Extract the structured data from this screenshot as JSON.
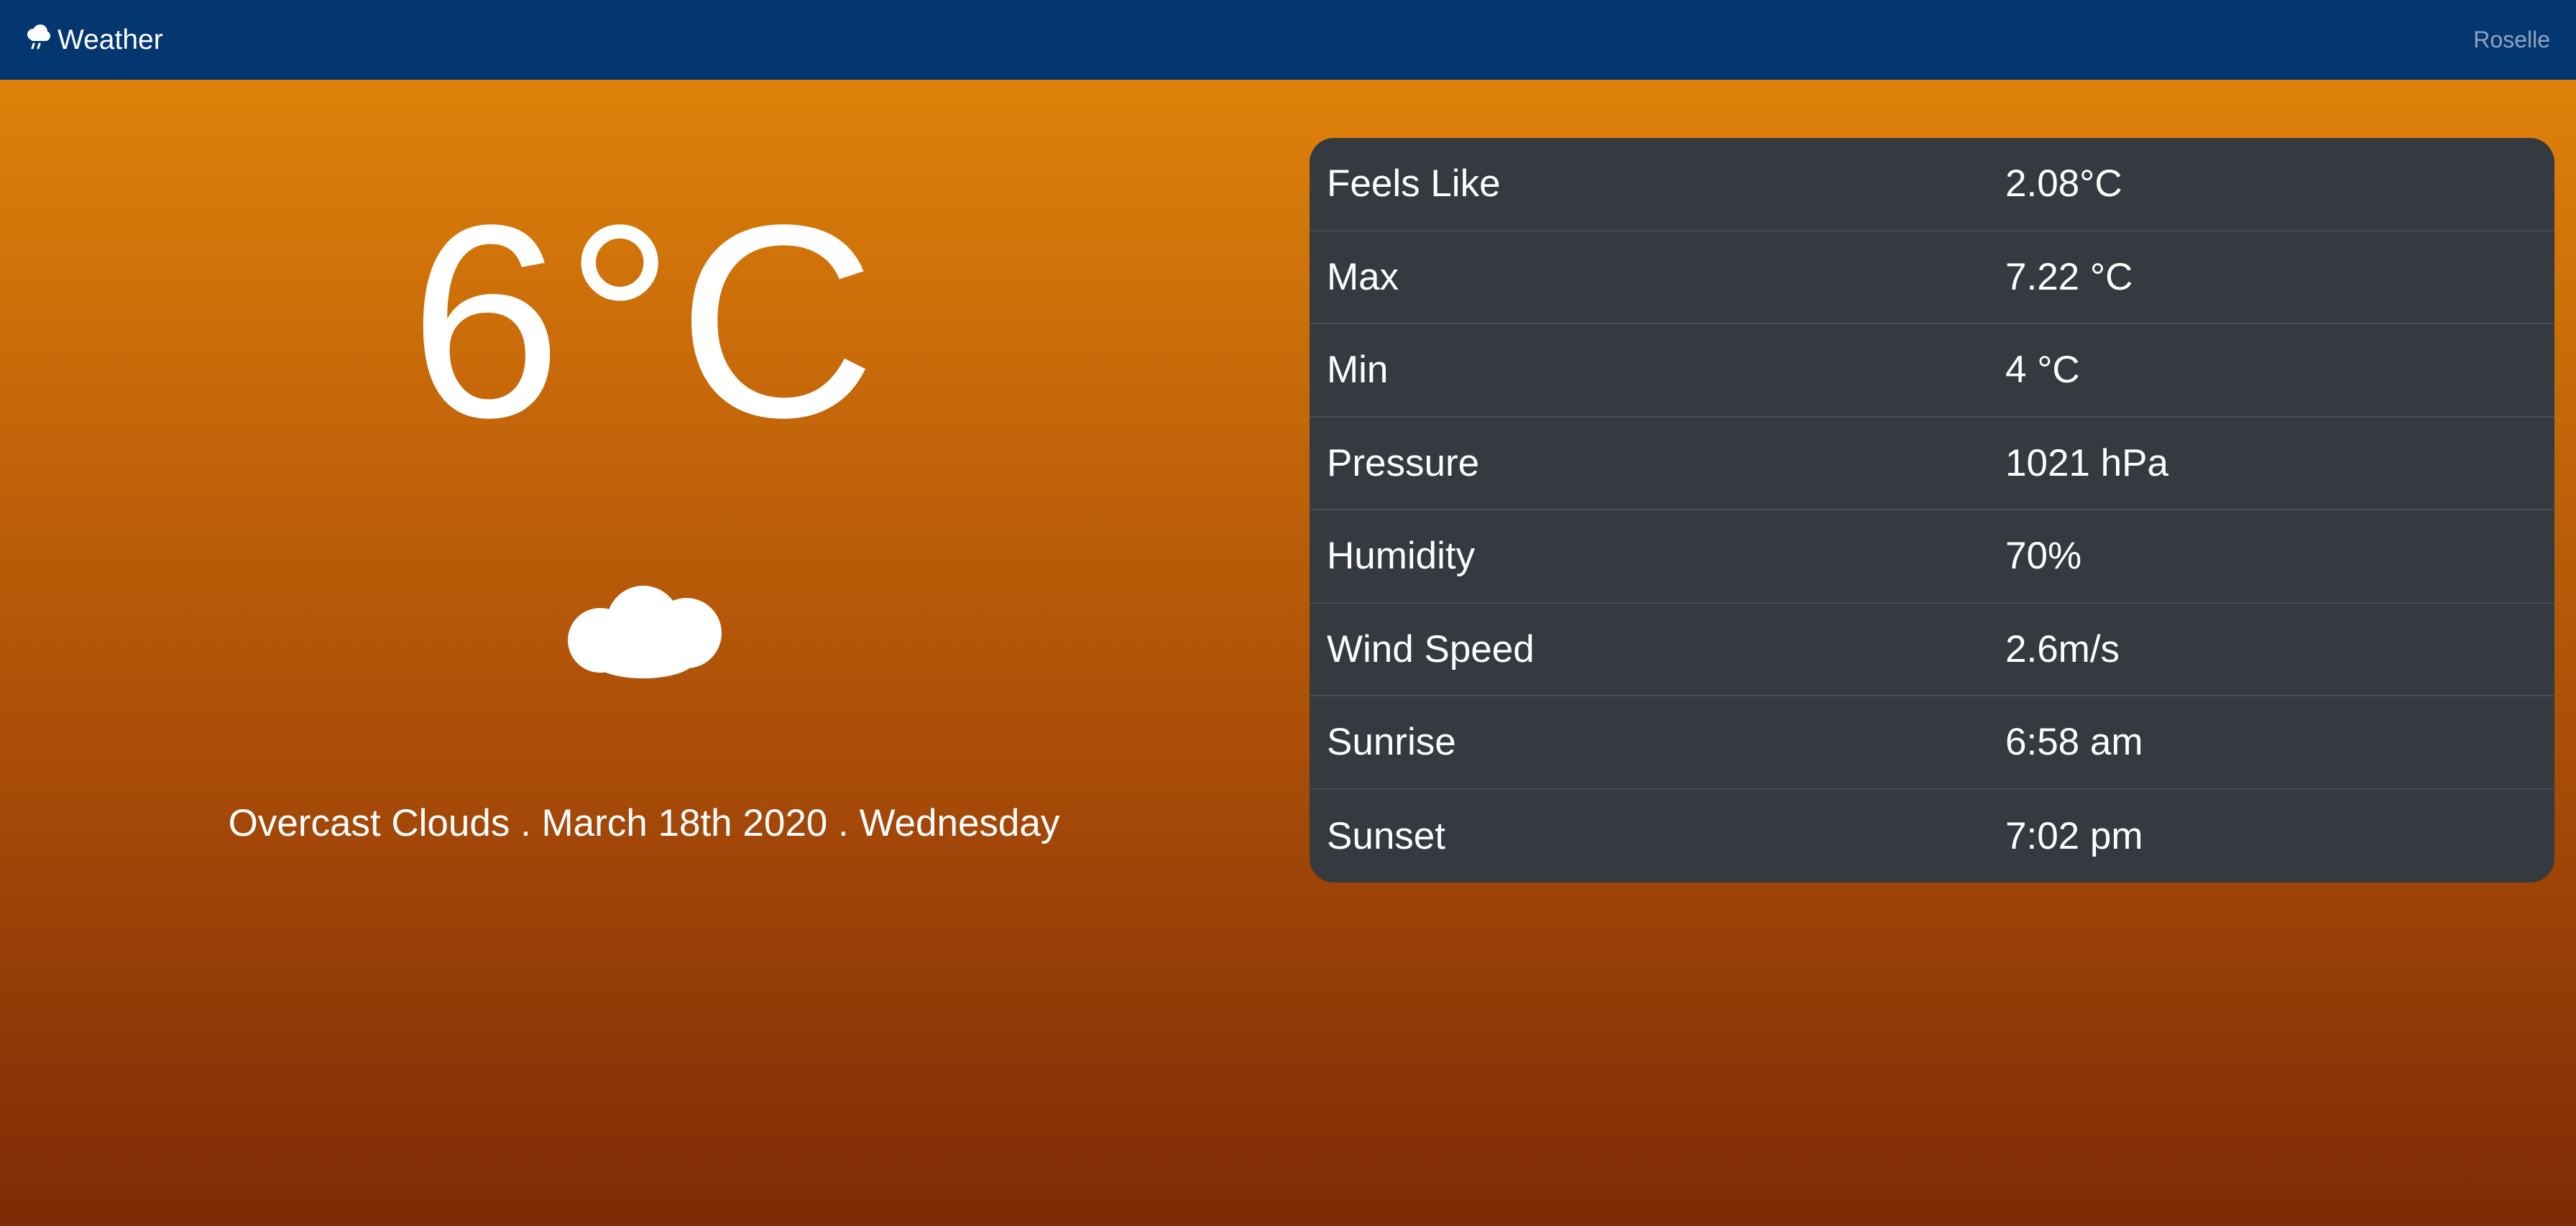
{
  "navbar": {
    "brand_icon": "cloud-rain-icon",
    "brand_label": "Weather",
    "city": "Roselle"
  },
  "current": {
    "temperature": "6°C",
    "condition_icon": "cloud-icon",
    "description": "Overcast Clouds . March 18th 2020 . Wednesday"
  },
  "details": [
    {
      "label": "Feels Like",
      "value": "2.08°C"
    },
    {
      "label": "Max",
      "value": "7.22 °C"
    },
    {
      "label": "Min",
      "value": "4 °C"
    },
    {
      "label": "Pressure",
      "value": "1021 hPa"
    },
    {
      "label": "Humidity",
      "value": "70%"
    },
    {
      "label": "Wind Speed",
      "value": "2.6m/s"
    },
    {
      "label": "Sunrise",
      "value": "6:58 am"
    },
    {
      "label": "Sunset",
      "value": "7:02 pm"
    }
  ],
  "colors": {
    "navbar": "#043670",
    "card": "#343a40",
    "gradient_top": "#e4880a",
    "gradient_bottom": "#7d2a06"
  }
}
